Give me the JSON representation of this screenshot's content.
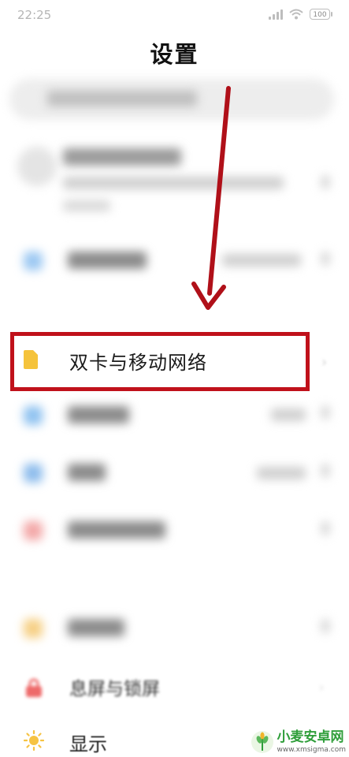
{
  "status_bar": {
    "time": "22:25",
    "battery": "100"
  },
  "page": {
    "title": "设置"
  },
  "rows": {
    "sim_network": {
      "label": "双卡与移动网络",
      "icon_color": "#f5c33b"
    },
    "lock_screen": {
      "label": "息屏与锁屏"
    },
    "display": {
      "label": "显示"
    }
  },
  "annotation": {
    "color": "#c0111b"
  },
  "watermark": {
    "name": "小麦安卓网",
    "url": "www.xmsigma.com"
  },
  "colors": {
    "wifi": "#7fb6ec",
    "bluetooth": "#6aa8e8",
    "connection": "#ef8a8a",
    "wallpaper": "#f3c26a",
    "lock": "#ee6a6a",
    "display": "#f6c343"
  }
}
